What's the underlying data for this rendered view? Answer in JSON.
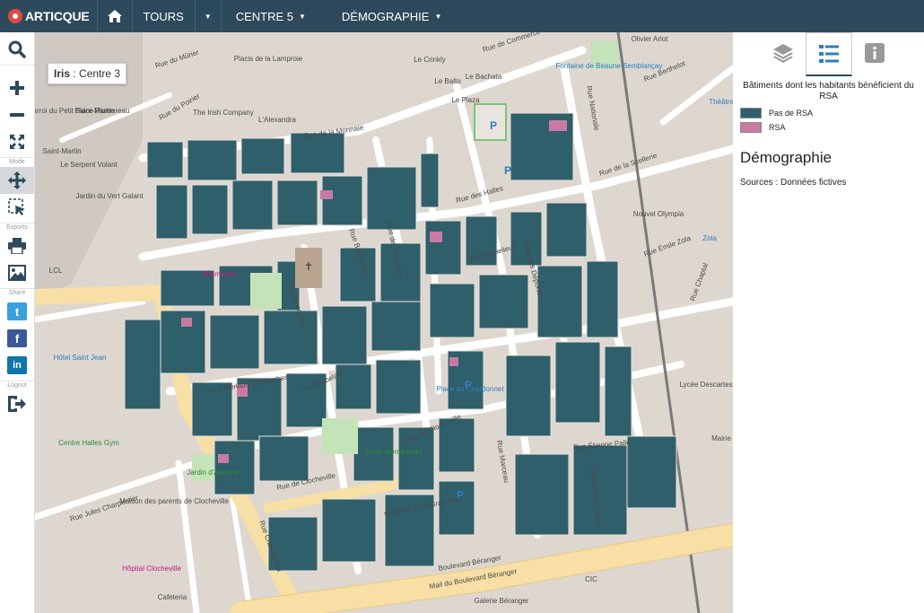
{
  "brand": {
    "name": "ARTICQUE"
  },
  "nav": {
    "tours": "TOURS",
    "centre": "CENTRE 5",
    "theme": "DÉMOGRAPHIE"
  },
  "sidebar": {
    "mode_label": "Mode",
    "exports_label": "Exports",
    "share_label": "Share",
    "logout_label": "Logout",
    "tools": [
      "search-icon",
      "zoom-in-icon",
      "zoom-out-icon",
      "fullscreen-icon",
      "pan-icon",
      "select-icon",
      "print-icon",
      "image-icon",
      "twitter-icon",
      "facebook-icon",
      "linkedin-icon",
      "logout-icon"
    ],
    "twitter_glyph": "t",
    "facebook_glyph": "f",
    "linkedin_glyph": "in"
  },
  "map": {
    "iris_label": "Iris",
    "iris_value": ": Centre 3",
    "colors": {
      "building_no_rsa": "#2f5f6a",
      "building_rsa": "#c97aa3",
      "boulevard": "#f7dfa5",
      "street": "#ffffff",
      "block": "#e5e0da"
    },
    "street_labels": [
      "Rue du Mûrier",
      "Rue du Poirier",
      "Rue de la Monnaie",
      "Rue des Halles",
      "Rue de Jérusalem",
      "Rue Richelieu",
      "Rue des Déportés",
      "Rue Descartes",
      "Rue Nériault Destouches",
      "Rue Rabelais",
      "Rue de Clocheville",
      "Rue Marceau",
      "Rue Étienne Pallu",
      "Impasse du Palais",
      "Impasse de la Grandière",
      "Boulevard Béranger",
      "Mail du Boulevard Béranger",
      "Rue Jules Charpentier",
      "Rue Chanoineau",
      "Rue de la Scellerie",
      "Rue Nationale",
      "Rue Berthelot",
      "Rue Émile Zola",
      "Rue Chaptal",
      "Rue de Commerce",
      "Rue Balesches"
    ],
    "place_labels": [
      "Place du Chardonnet",
      "Jardin du Vert Galant",
      "Hôtel Saint Jean",
      "Centre Halles Gym",
      "Lycée Descartes",
      "Maison des parents de Clocheville",
      "Hôpital Clocheville",
      "Nouvel Olympia",
      "Place Plumereau",
      "Le Plaza",
      "Pharmacie",
      "Jardin d'Aumont",
      "École élémentaire",
      "The Irish Company",
      "L'Alexandra",
      "Cafeteria",
      "CIC",
      "Galerie Béranger",
      "Le Crinkly",
      "Le Bachata",
      "Fontaine de Beaune-Semblançay",
      "Saint-Martin",
      "Le Balto",
      "Carroi du Petit Saint-Martin",
      "LCL",
      "Placis de la Lamproie",
      "Olivier Arlot",
      "Mairie",
      "Le Serpent Volant",
      "Théâtre",
      "Zola"
    ]
  },
  "panel": {
    "tabs": [
      "layers-icon",
      "legend-icon",
      "info-icon"
    ],
    "legend_title": "Bâtiments dont les habitants bénéficient du RSA",
    "legend": [
      {
        "label": "Pas de RSA",
        "color": "#2f5f6a"
      },
      {
        "label": "RSA",
        "color": "#c97aa3"
      }
    ],
    "heading": "Démographie",
    "sources": "Sources : Données fictives"
  }
}
